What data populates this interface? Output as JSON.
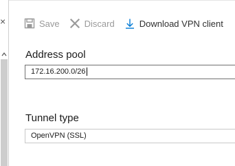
{
  "toolbar": {
    "save_label": "Save",
    "discard_label": "Discard",
    "download_label": "Download VPN client",
    "icons": {
      "save": "save-icon",
      "discard": "close-icon",
      "download": "download-icon"
    }
  },
  "form": {
    "address_pool": {
      "label": "Address pool",
      "value": "172.16.200.0/26"
    },
    "tunnel_type": {
      "label": "Tunnel type",
      "selected": "OpenVPN (SSL)"
    }
  },
  "colors": {
    "accent": "#0078d4",
    "disabled_text": "#9a9a9a",
    "text": "#1a1a1a"
  }
}
